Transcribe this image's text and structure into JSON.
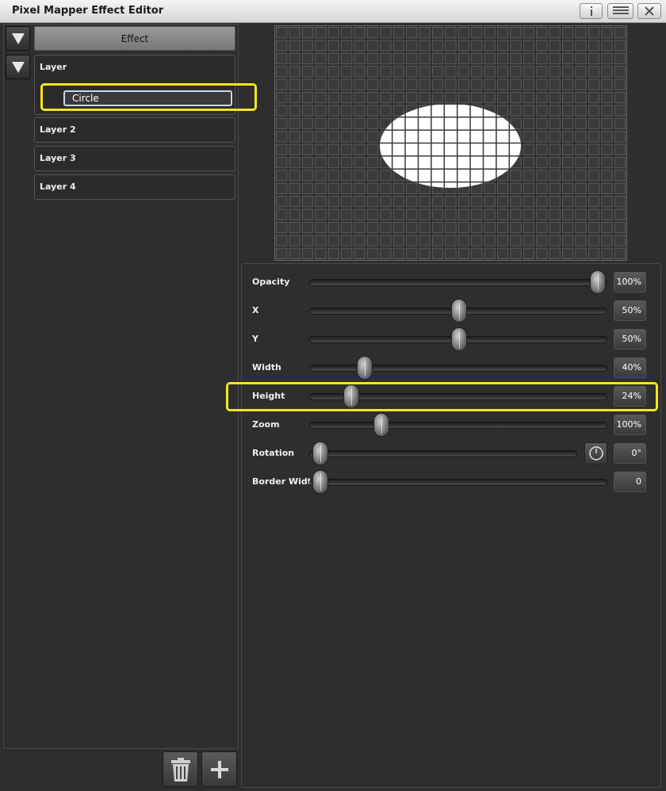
{
  "window": {
    "title": "Pixel Mapper Effect Editor",
    "info_icon": "info-icon",
    "menu_icon": "menu-icon",
    "close_icon": "close-icon"
  },
  "effect": {
    "label": "Effect"
  },
  "layers": [
    {
      "label": "Layer",
      "shape": "Circle"
    },
    {
      "label": "Layer 2"
    },
    {
      "label": "Layer 3"
    },
    {
      "label": "Layer 4"
    }
  ],
  "properties": [
    {
      "label": "Opacity",
      "value": "100%",
      "fraction": 1.0
    },
    {
      "label": "X",
      "value": "50%",
      "fraction": 0.5
    },
    {
      "label": "Y",
      "value": "50%",
      "fraction": 0.5
    },
    {
      "label": "Width",
      "value": "40%",
      "fraction": 0.16
    },
    {
      "label": "Height",
      "value": "24%",
      "fraction": 0.11
    },
    {
      "label": "Zoom",
      "value": "100%",
      "fraction": 0.22
    },
    {
      "label": "Rotation",
      "value": "0°",
      "fraction": 0.0
    },
    {
      "label": "Border Width",
      "value": "0",
      "fraction": 0.0
    }
  ],
  "colors": {
    "highlight": "#f2e51f",
    "background": "#2e2e2e"
  }
}
